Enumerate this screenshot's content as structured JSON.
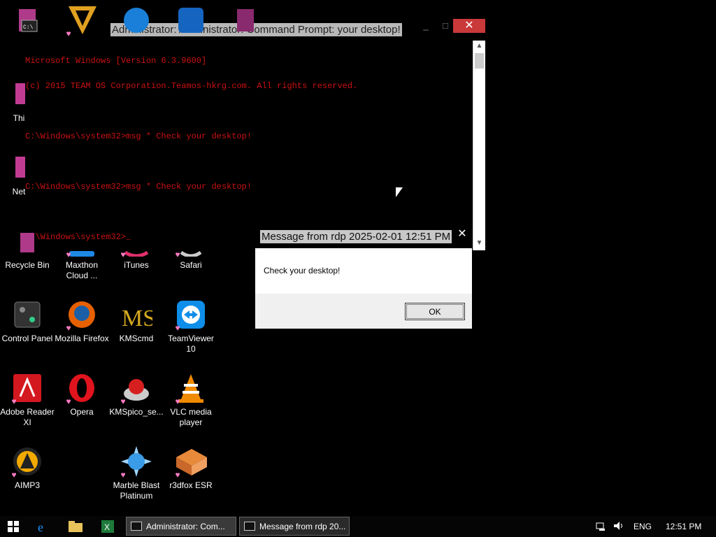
{
  "desktop_icons": [
    {
      "id": "thi",
      "label": "Thi"
    },
    {
      "id": "net",
      "label": "Net"
    },
    {
      "id": "recycle",
      "label": "Recycle Bin"
    },
    {
      "id": "maxthon",
      "label": "Maxthon Cloud ..."
    },
    {
      "id": "itunes",
      "label": "iTunes"
    },
    {
      "id": "safari",
      "label": "Safari"
    },
    {
      "id": "control",
      "label": "Control Panel"
    },
    {
      "id": "firefox",
      "label": "Mozilla Firefox"
    },
    {
      "id": "kmscmd",
      "label": "KMScmd"
    },
    {
      "id": "teamviewer",
      "label": "TeamViewer 10"
    },
    {
      "id": "adobe",
      "label": "Adobe Reader XI"
    },
    {
      "id": "opera",
      "label": "Opera"
    },
    {
      "id": "kmspico",
      "label": "KMSpico_se..."
    },
    {
      "id": "vlc",
      "label": "VLC media player"
    },
    {
      "id": "aimp",
      "label": "AIMP3"
    },
    {
      "id": "marble",
      "label": "Marble Blast Platinum"
    },
    {
      "id": "r3dfox",
      "label": "r3dfox ESR"
    }
  ],
  "cmd": {
    "title": "Administrator: Administrator: Command Prompt: your desktop!",
    "min_label": "_",
    "max_label": "□",
    "close_label": "✕",
    "lines": [
      "Microsoft Windows [Version 6.3.9600]",
      "(c) 2015 TEAM OS Corporation.Teamos-hkrg.com. All rights reserved.",
      "",
      "C:\\Windows\\system32>msg * Check your desktop!",
      "",
      "C:\\Windows\\system32>msg * Check your desktop!",
      "",
      "C:\\Windows\\system32>_"
    ]
  },
  "msgbox": {
    "title": "Message from rdp 2025-02-01 12:51 PM",
    "close_label": "✕",
    "text": "Check your desktop!",
    "ok_label": "OK"
  },
  "taskbar": {
    "tasks": [
      {
        "label": "Administrator: Com..."
      },
      {
        "label": "Message from rdp 20..."
      }
    ],
    "lang": "ENG",
    "time": "12:51 PM"
  },
  "colors": {
    "cmd_text": "#cc1111",
    "close_button": "#c9393a",
    "heart": "#ff7cc4"
  }
}
